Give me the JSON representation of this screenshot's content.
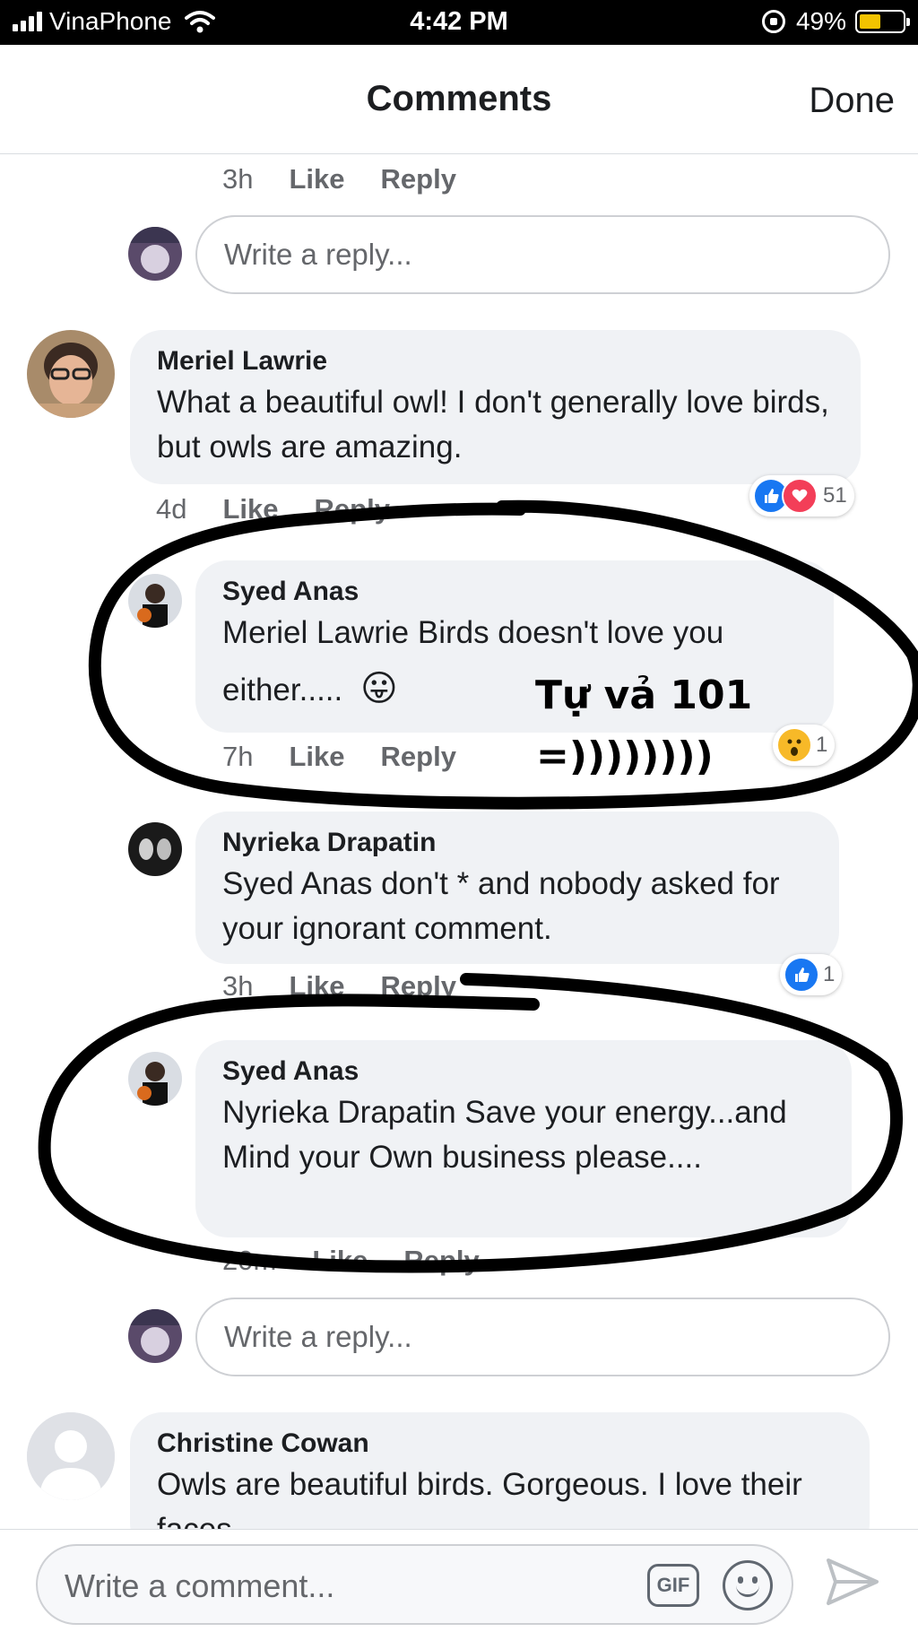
{
  "status_bar": {
    "carrier": "VinaPhone",
    "time": "4:42 PM",
    "battery": "49%",
    "battery_level": 0.49
  },
  "header": {
    "title": "Comments",
    "done_label": "Done"
  },
  "top_meta": {
    "time": "3h",
    "like": "Like",
    "reply": "Reply"
  },
  "reply_placeholder": "Write a reply...",
  "comments": [
    {
      "name": "Meriel Lawrie",
      "text": "What a beautiful owl! I don't generally love birds, but owls are amazing.",
      "time": "4d",
      "like": "Like",
      "reply": "Reply",
      "reaction_count": "51",
      "reaction_icons": [
        "like-icon",
        "love-icon"
      ]
    },
    {
      "name": "Syed Anas",
      "text_1": "Meriel Lawrie  Birds doesn't love you",
      "text_2": "either.....",
      "emoji": "😛",
      "time": "7h",
      "like": "Like",
      "reply": "Reply",
      "reaction_count": "1",
      "reaction_icons": [
        "wow-icon"
      ]
    },
    {
      "name": "Nyrieka Drapatin",
      "text": "Syed Anas don't * and nobody asked for your ignorant comment.",
      "time": "3h",
      "like": "Like",
      "reply": "Reply",
      "reaction_count": "1",
      "reaction_icons": [
        "like-icon"
      ]
    },
    {
      "name": "Syed Anas",
      "text": "Nyrieka Drapatin  Save your energy...and Mind your Own business please....",
      "time": "20m",
      "like": "Like",
      "reply": "Reply"
    },
    {
      "name": "Christine Cowan",
      "text": "Owls are beautiful birds.  Gorgeous.   I love their faces"
    }
  ],
  "annotation": {
    "line_1": "Tự vả 101",
    "line_2": "=))))))))"
  },
  "composer": {
    "placeholder": "Write a comment...",
    "gif_label": "GIF"
  },
  "colors": {
    "bubble": "#f0f2f5",
    "meta_text": "#65676b",
    "like_blue": "#1877f2",
    "love_red": "#f33e58",
    "wow_yellow": "#f7b928",
    "battery_yellow": "#f2c300"
  }
}
